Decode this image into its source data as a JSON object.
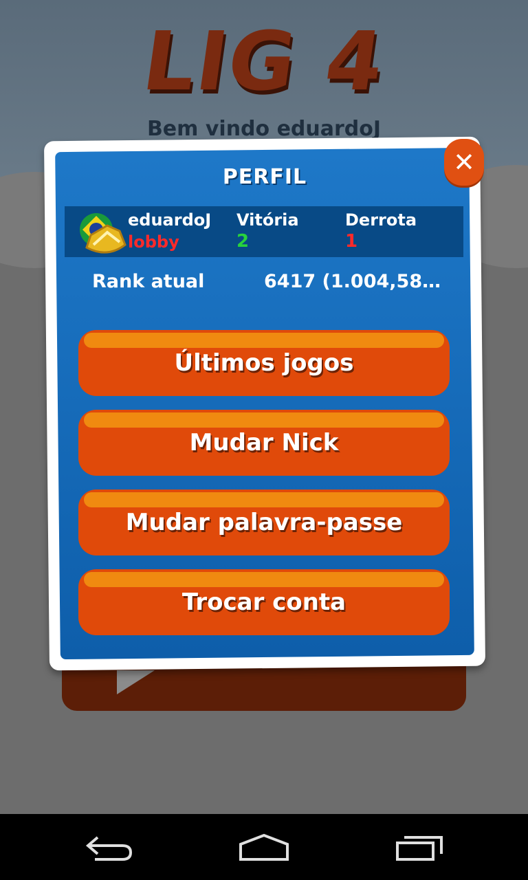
{
  "background": {
    "game_title": "LIG 4",
    "welcome": "Bem vindo eduardoJ"
  },
  "dialog": {
    "title": "PERFIL",
    "close_icon": "close-icon",
    "user": {
      "avatar_icon": "brazil-flag-rank-badge-icon",
      "username": "eduardoJ",
      "status": "lobby",
      "wins_label": "Vitória",
      "wins": "2",
      "losses_label": "Derrota",
      "losses": "1"
    },
    "rank": {
      "label": "Rank atual",
      "value": "6417 (1.004,58 Pt..."
    },
    "buttons": [
      {
        "label": "Últimos jogos"
      },
      {
        "label": "Mudar Nick"
      },
      {
        "label": "Mudar palavra-passe"
      },
      {
        "label": "Trocar conta"
      }
    ]
  },
  "navbar": {
    "back_icon": "back-icon",
    "home_icon": "home-icon",
    "recents_icon": "recent-apps-icon"
  },
  "colors": {
    "dialog_blue": "#1e78c8",
    "button_orange": "#e04a0a",
    "win_green": "#28d23c",
    "loss_red": "#ff2a2a"
  }
}
